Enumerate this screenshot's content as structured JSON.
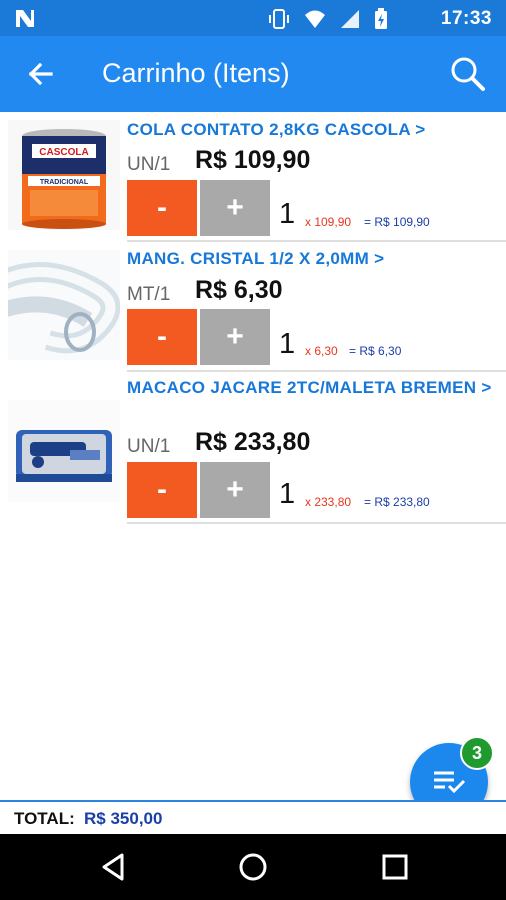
{
  "status_bar": {
    "time": "17:33",
    "brand_icon": "n-logo-icon",
    "icons": [
      "vibrate-icon",
      "wifi-icon",
      "signal-icon",
      "battery-charging-icon"
    ]
  },
  "app_bar": {
    "title": "Carrinho (Itens)",
    "back_icon": "arrow-back-icon",
    "search_icon": "search-icon"
  },
  "cart": {
    "items": [
      {
        "name": "COLA CONTATO 2,8KG CASCOLA >",
        "unit": "UN/1",
        "price": "R$ 109,90",
        "minus_label": "-",
        "plus_label": "+",
        "quantity": "1",
        "unit_calc": "x 109,90",
        "line_total": "= R$ 109,90",
        "image": "glue-can-image",
        "image_text": "CASCOLA",
        "image_text2": "TRADICIONAL"
      },
      {
        "name": "MANG. CRISTAL 1/2 X 2,0MM >",
        "unit": "MT/1",
        "price": "R$ 6,30",
        "minus_label": "-",
        "plus_label": "+",
        "quantity": "1",
        "unit_calc": "x 6,30",
        "line_total": "= R$ 6,30",
        "image": "clear-hose-image"
      },
      {
        "name": "MACACO JACARE 2TC/MALETA BREMEN >",
        "unit": "UN/1",
        "price": "R$ 233,80",
        "minus_label": "-",
        "plus_label": "+",
        "quantity": "1",
        "unit_calc": "x 233,80",
        "line_total": "= R$ 233,80",
        "image": "jack-case-image"
      }
    ]
  },
  "fab": {
    "icon": "checklist-icon",
    "badge": "3"
  },
  "footer": {
    "total_label": "TOTAL:",
    "total_value": "R$ 350,00"
  },
  "nav_bar": {
    "back_icon": "nav-back-icon",
    "home_icon": "nav-home-icon",
    "recents_icon": "nav-recents-icon"
  },
  "colors": {
    "status_bar": "#1b79d8",
    "app_bar": "#2189f0",
    "minus_button": "#f25a22",
    "plus_button": "#a9a9a9",
    "product_name": "#1778d8",
    "unit_calc": "#e8361c",
    "line_total": "#1a3fa8",
    "badge": "#1f9a2e"
  }
}
